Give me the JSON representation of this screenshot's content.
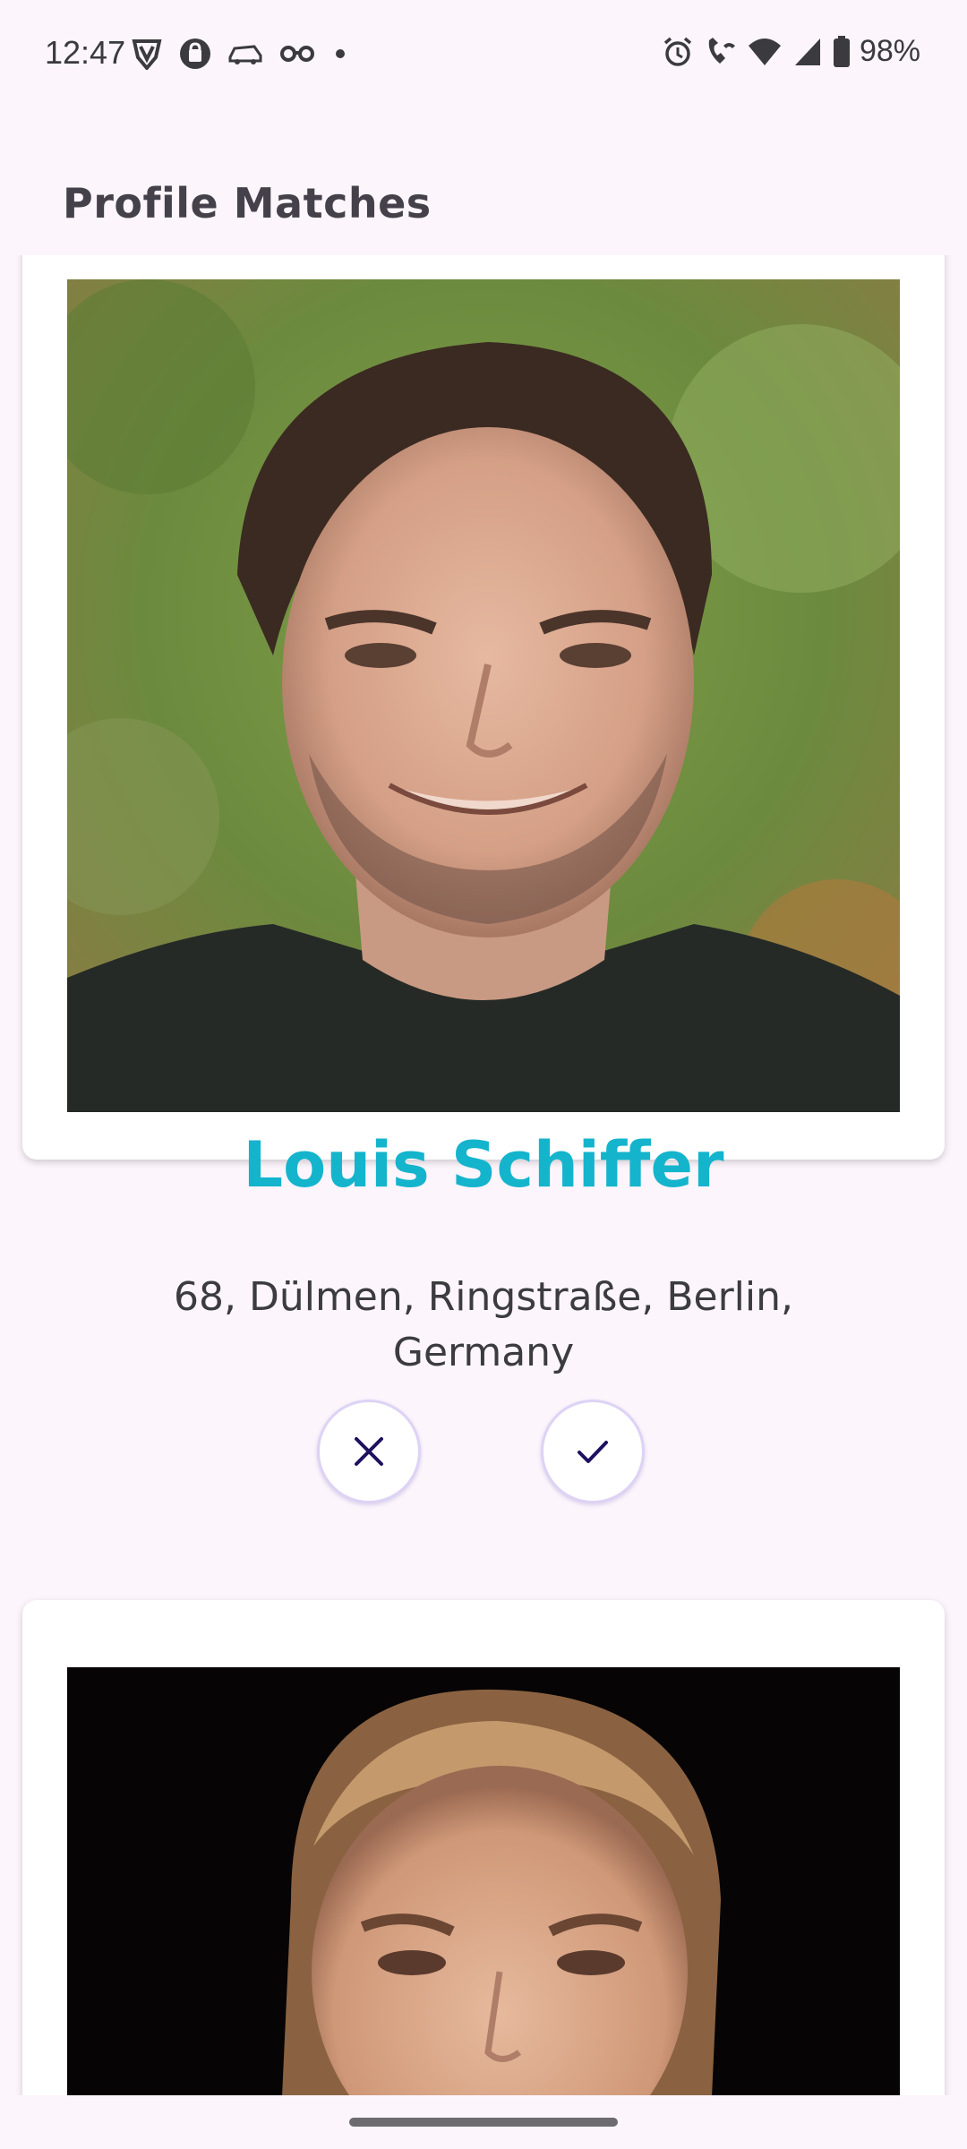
{
  "status_bar": {
    "time": "12:47",
    "battery": "98%",
    "left_icons": [
      "vpn-shield-icon",
      "bag-icon",
      "car-icon",
      "glasses-icon",
      "dot-icon"
    ],
    "right_icons": [
      "alarm-icon",
      "wifi-call-icon",
      "wifi-icon",
      "signal-icon",
      "battery-icon"
    ]
  },
  "app_bar": {
    "title": "Profile Matches"
  },
  "profiles": [
    {
      "name": "Louis Schiffer",
      "location": "68, Dülmen, Ringstraße, Berlin, Germany",
      "reject_icon": "close-icon",
      "accept_icon": "check-icon"
    }
  ],
  "colors": {
    "background": "#fcf5fc",
    "name": "#14b4cc",
    "icon": "#1d1160",
    "button_border": "#ddd3f5"
  }
}
